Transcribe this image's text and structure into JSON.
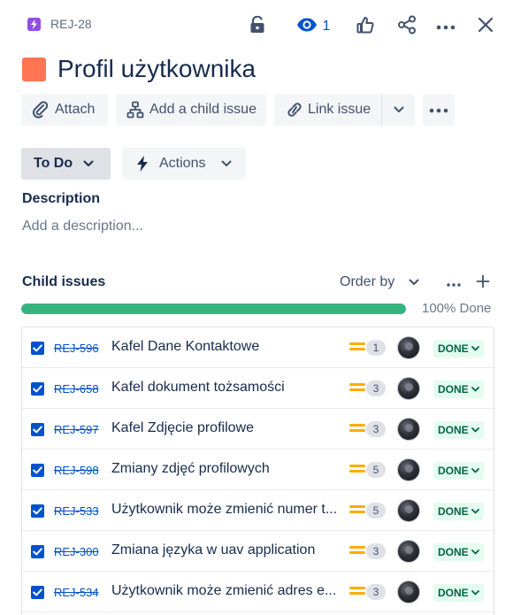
{
  "header": {
    "issue_key": "REJ-28",
    "watch_count": "1",
    "icons": [
      "lock-icon",
      "eye-icon",
      "thumbs-up-icon",
      "share-icon",
      "more-icon",
      "close-icon"
    ]
  },
  "title": "Profil użytkownika",
  "toolbar": {
    "attach_label": "Attach",
    "add_child_label": "Add a child issue",
    "link_issue_label": "Link issue"
  },
  "status": {
    "label": "To Do",
    "actions_label": "Actions"
  },
  "description": {
    "label": "Description",
    "placeholder": "Add a description..."
  },
  "child_issues": {
    "label": "Child issues",
    "order_by_label": "Order by",
    "progress_percent": 100,
    "progress_label": "100% Done",
    "items": [
      {
        "key": "REJ-596",
        "summary": "Kafel Dane Kontaktowe",
        "points": "1",
        "status": "DONE"
      },
      {
        "key": "REJ-658",
        "summary": "Kafel dokument tożsamości",
        "points": "3",
        "status": "DONE"
      },
      {
        "key": "REJ-597",
        "summary": "Kafel Zdjęcie profilowe",
        "points": "3",
        "status": "DONE"
      },
      {
        "key": "REJ-598",
        "summary": "Zmiany zdjęć profilowych",
        "points": "5",
        "status": "DONE"
      },
      {
        "key": "REJ-533",
        "summary": "Użytkownik może zmienić numer t...",
        "points": "5",
        "status": "DONE"
      },
      {
        "key": "REJ-300",
        "summary": "Zmiana języka w uav application",
        "points": "3",
        "status": "DONE"
      },
      {
        "key": "REJ-534",
        "summary": "Użytkownik może zmienić adres e...",
        "points": "3",
        "status": "DONE"
      }
    ]
  },
  "colors": {
    "accent": "#0052cc",
    "epic": "#904ee2",
    "swatch": "#ff7452",
    "progress": "#36b37e",
    "priority": "#ffab00",
    "done_bg": "#e3fcef",
    "done_text": "#006644"
  }
}
